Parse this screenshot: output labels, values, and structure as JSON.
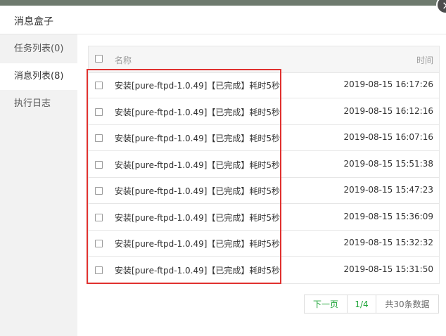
{
  "window": {
    "title": "消息盒子",
    "close_label": "×"
  },
  "sidebar": {
    "items": [
      {
        "label": "任务列表(0)"
      },
      {
        "label": "消息列表(8)"
      },
      {
        "label": "执行日志"
      }
    ],
    "active_index": 1
  },
  "table": {
    "headers": {
      "name": "名称",
      "time": "时间"
    },
    "rows": [
      {
        "name": "安装[pure-ftpd-1.0.49]【已完成】耗时5秒",
        "time": "2019-08-15 16:17:26"
      },
      {
        "name": "安装[pure-ftpd-1.0.49]【已完成】耗时5秒",
        "time": "2019-08-15 16:12:16"
      },
      {
        "name": "安装[pure-ftpd-1.0.49]【已完成】耗时5秒",
        "time": "2019-08-15 16:07:16"
      },
      {
        "name": "安装[pure-ftpd-1.0.49]【已完成】耗时5秒",
        "time": "2019-08-15 15:51:38"
      },
      {
        "name": "安装[pure-ftpd-1.0.49]【已完成】耗时5秒",
        "time": "2019-08-15 15:47:23"
      },
      {
        "name": "安装[pure-ftpd-1.0.49]【已完成】耗时5秒",
        "time": "2019-08-15 15:36:09"
      },
      {
        "name": "安装[pure-ftpd-1.0.49]【已完成】耗时5秒",
        "time": "2019-08-15 15:32:32"
      },
      {
        "name": "安装[pure-ftpd-1.0.49]【已完成】耗时5秒",
        "time": "2019-08-15 15:31:50"
      }
    ]
  },
  "pagination": {
    "next_label": "下一页",
    "page": "1/4",
    "total": "共30条数据"
  },
  "colors": {
    "accent": "#20a53a",
    "highlight": "#e0312f",
    "sidebar_bg": "#f2f2f2"
  }
}
